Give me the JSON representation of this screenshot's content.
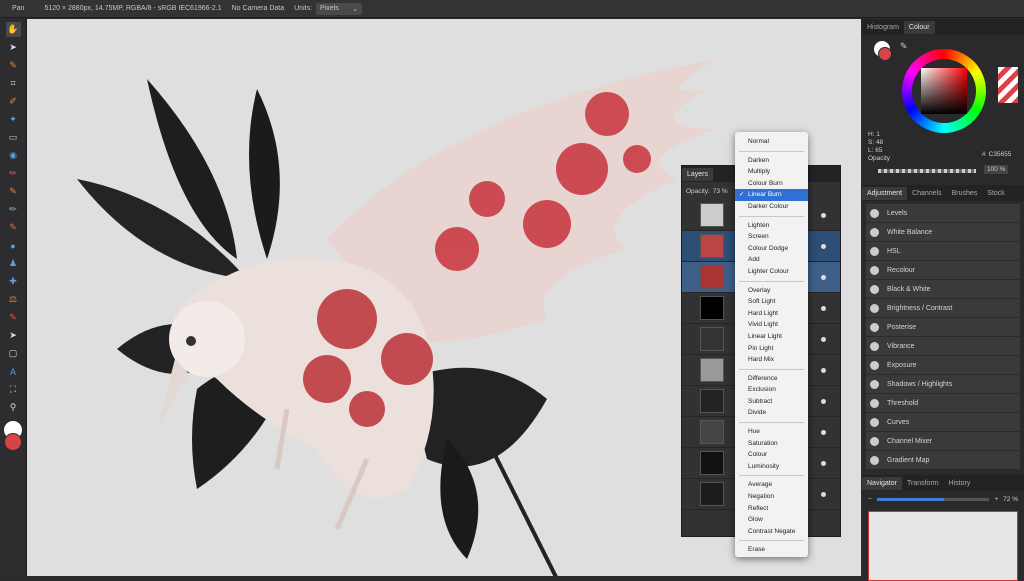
{
  "topbar": {
    "tool_name": "Pan",
    "doc_info": "5120 × 2880px, 14.75MP, RGBA/8 - sRGB IEC61966-2.1",
    "camera": "No Camera Data",
    "units_label": "Units:",
    "units_value": "Pixels"
  },
  "colour_panel": {
    "tabs": [
      "Histogram",
      "Colour"
    ],
    "active_tab": "Colour",
    "h": "H: 1",
    "s": "S: 48",
    "l": "L: 65",
    "hex": "C35655",
    "opacity_label": "Opacity",
    "opacity_value": "100 %",
    "fill_color": "#d8434a"
  },
  "adjustment_panel": {
    "tabs": [
      "Adjustment",
      "Channels",
      "Brushes",
      "Stock"
    ],
    "active_tab": "Adjustment",
    "items": [
      "Levels",
      "White Balance",
      "HSL",
      "Recolour",
      "Black & White",
      "Brightness / Contrast",
      "Posterise",
      "Vibrance",
      "Exposure",
      "Shadows / Highlights",
      "Threshold",
      "Curves",
      "Channel Mixer",
      "Gradient Map"
    ]
  },
  "navigator_panel": {
    "tabs": [
      "Navigator",
      "Transform",
      "History"
    ],
    "active_tab": "Navigator",
    "zoom": "72 %"
  },
  "layers_panel": {
    "tab": "Layers",
    "opacity_label": "Opacity:",
    "opacity_value": "73 %"
  },
  "blend_menu": {
    "selected": "Linear Burn",
    "groups": [
      [
        "Normal"
      ],
      [
        "Darken",
        "Multiply",
        "Colour Burn",
        "Linear Burn",
        "Darker Colour"
      ],
      [
        "Lighten",
        "Screen",
        "Colour Dodge",
        "Add",
        "Lighter Colour"
      ],
      [
        "Overlay",
        "Soft Light",
        "Hard Light",
        "Vivid Light",
        "Linear Light",
        "Pin Light",
        "Hard Mix"
      ],
      [
        "Difference",
        "Exclusion",
        "Subtract",
        "Divide"
      ],
      [
        "Hue",
        "Saturation",
        "Colour",
        "Luminosity"
      ],
      [
        "Average",
        "Negation",
        "Reflect",
        "Glow",
        "Contrast Negate"
      ],
      [
        "Erase"
      ]
    ]
  }
}
